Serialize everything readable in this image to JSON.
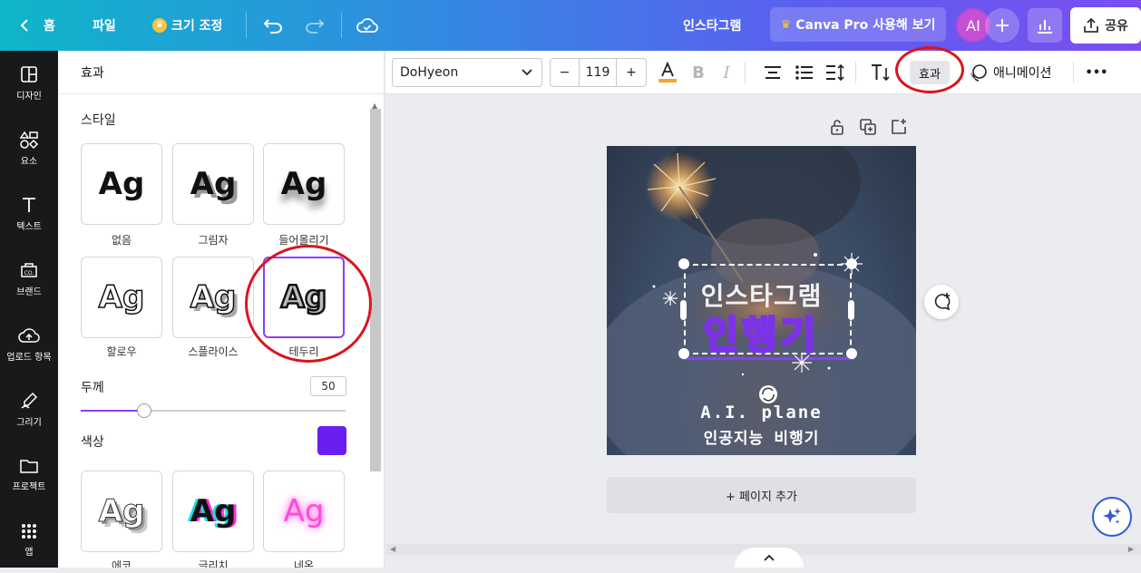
{
  "topbar": {
    "home": "홈",
    "file": "파일",
    "resize": "크기 조정",
    "doc_title": "인스타그램",
    "pro_cta": "Canva Pro 사용해 보기",
    "avatar_initials": "AI",
    "share": "공유"
  },
  "rail": {
    "items": [
      {
        "label": "디자인",
        "icon": "layout-icon"
      },
      {
        "label": "요소",
        "icon": "shapes-icon"
      },
      {
        "label": "텍스트",
        "icon": "text-icon"
      },
      {
        "label": "브랜드",
        "icon": "brand-icon"
      },
      {
        "label": "업로드 항목",
        "icon": "upload-icon"
      },
      {
        "label": "그리기",
        "icon": "draw-icon"
      },
      {
        "label": "프로젝트",
        "icon": "folder-icon"
      },
      {
        "label": "앱",
        "icon": "apps-icon"
      }
    ]
  },
  "panel": {
    "title": "효과",
    "style_heading": "스타일",
    "styles": [
      {
        "label": "없음",
        "sample": "Ag"
      },
      {
        "label": "그림자",
        "sample": "Ag"
      },
      {
        "label": "들어올리기",
        "sample": "Ag"
      },
      {
        "label": "할로우",
        "sample": "Ag"
      },
      {
        "label": "스플라이스",
        "sample": "Ag"
      },
      {
        "label": "테두리",
        "sample": "Ag"
      },
      {
        "label": "에코",
        "sample": "Ag"
      },
      {
        "label": "글리치",
        "sample": "Ag"
      },
      {
        "label": "네온",
        "sample": "Ag"
      }
    ],
    "thickness_label": "두께",
    "thickness_value": "50",
    "thickness_fraction": 0.5,
    "color_label": "색상",
    "color_value": "#6a1ef0"
  },
  "toolbar": {
    "font": "DoHyeon",
    "minus": "−",
    "size": "119",
    "plus": "+",
    "effects": "효과",
    "animate": "애니메이션",
    "more": "•••"
  },
  "canvas": {
    "add_page": "+ 페이지 추가",
    "design_line1": "인스타그램",
    "design_line2": "인행기",
    "design_line3": "A.I. plane",
    "design_line4": "인공지능 비행기"
  },
  "colors": {
    "accent": "#8b3dff",
    "annotation": "#d9151c",
    "design_orange": "#ff9e4a"
  }
}
